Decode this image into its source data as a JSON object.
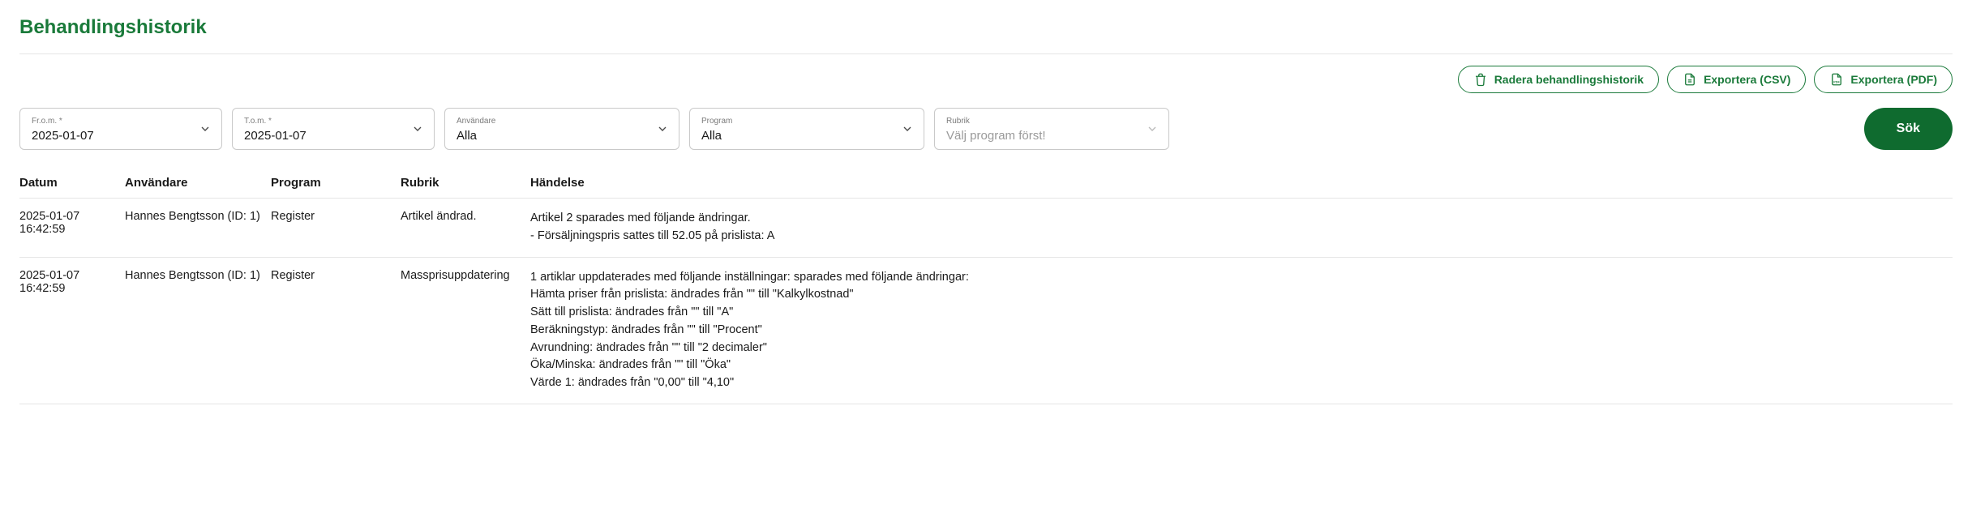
{
  "page_title": "Behandlingshistorik",
  "actions": {
    "delete": "Radera behandlingshistorik",
    "export_csv": "Exportera (CSV)",
    "export_pdf": "Exportera (PDF)"
  },
  "filters": {
    "from": {
      "label": "Fr.o.m. *",
      "value": "2025-01-07"
    },
    "to": {
      "label": "T.o.m. *",
      "value": "2025-01-07"
    },
    "user": {
      "label": "Användare",
      "value": "Alla"
    },
    "program": {
      "label": "Program",
      "value": "Alla"
    },
    "rubrik": {
      "label": "Rubrik",
      "placeholder": "Välj program först!"
    },
    "search": "Sök"
  },
  "table": {
    "headers": {
      "datum": "Datum",
      "anvandare": "Användare",
      "program": "Program",
      "rubrik": "Rubrik",
      "handelse": "Händelse"
    },
    "rows": [
      {
        "datum": "2025-01-07 16:42:59",
        "anvandare": "Hannes Bengtsson (ID: 1)",
        "program": "Register",
        "rubrik": "Artikel ändrad.",
        "handelse": [
          "Artikel 2 sparades med följande ändringar.",
          "- Försäljningspris sattes till 52.05 på prislista: A"
        ]
      },
      {
        "datum": "2025-01-07 16:42:59",
        "anvandare": "Hannes Bengtsson (ID: 1)",
        "program": "Register",
        "rubrik": "Massprisuppdatering",
        "handelse": [
          "1 artiklar uppdaterades med följande inställningar: sparades med följande ändringar:",
          "Hämta priser från prislista: ändrades från \"\" till \"Kalkylkostnad\"",
          "Sätt till prislista: ändrades från \"\" till \"A\"",
          "Beräkningstyp: ändrades från \"\" till \"Procent\"",
          "Avrundning: ändrades från \"\" till \"2 decimaler\"",
          "Öka/Minska: ändrades från \"\" till \"Öka\"",
          "Värde 1: ändrades från \"0,00\" till \"4,10\""
        ]
      }
    ]
  }
}
